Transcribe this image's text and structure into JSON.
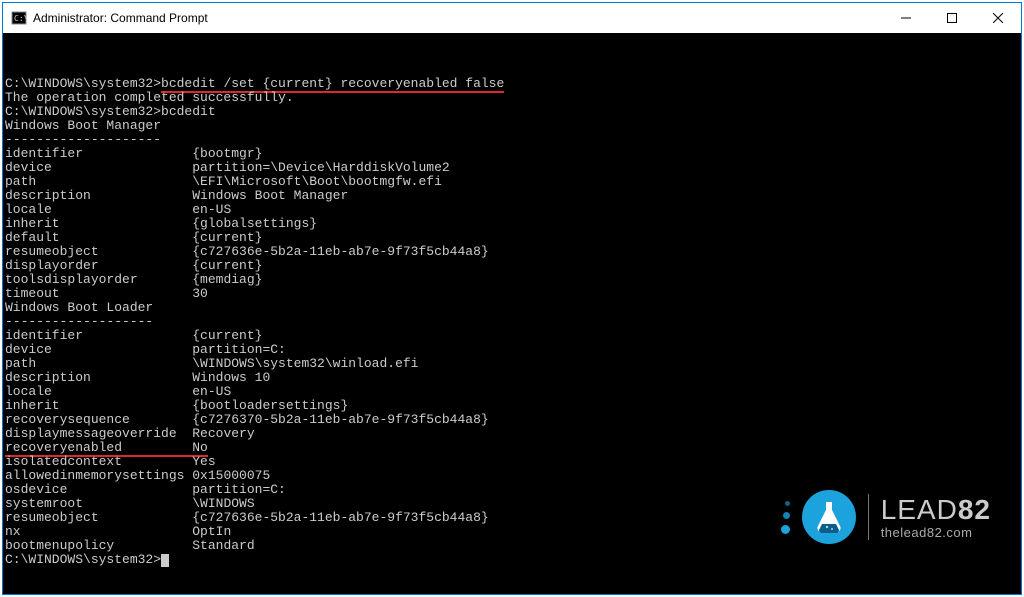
{
  "window": {
    "title": "Administrator: Command Prompt"
  },
  "terminal": {
    "prompt": "C:\\WINDOWS\\system32>",
    "cmd1": "bcdedit /set {current} recoveryenabled false",
    "cmd1_result": "The operation completed successfully.",
    "cmd2": "bcdedit",
    "section1_title": "Windows Boot Manager",
    "section1_divider": "--------------------",
    "section2_title": "Windows Boot Loader",
    "section2_divider": "-------------------",
    "bootmgr": [
      {
        "k": "identifier",
        "v": "{bootmgr}"
      },
      {
        "k": "device",
        "v": "partition=\\Device\\HarddiskVolume2"
      },
      {
        "k": "path",
        "v": "\\EFI\\Microsoft\\Boot\\bootmgfw.efi"
      },
      {
        "k": "description",
        "v": "Windows Boot Manager"
      },
      {
        "k": "locale",
        "v": "en-US"
      },
      {
        "k": "inherit",
        "v": "{globalsettings}"
      },
      {
        "k": "default",
        "v": "{current}"
      },
      {
        "k": "resumeobject",
        "v": "{c727636e-5b2a-11eb-ab7e-9f73f5cb44a8}"
      },
      {
        "k": "displayorder",
        "v": "{current}"
      },
      {
        "k": "toolsdisplayorder",
        "v": "{memdiag}"
      },
      {
        "k": "timeout",
        "v": "30"
      }
    ],
    "bootloader": [
      {
        "k": "identifier",
        "v": "{current}"
      },
      {
        "k": "device",
        "v": "partition=C:"
      },
      {
        "k": "path",
        "v": "\\WINDOWS\\system32\\winload.efi"
      },
      {
        "k": "description",
        "v": "Windows 10"
      },
      {
        "k": "locale",
        "v": "en-US"
      },
      {
        "k": "inherit",
        "v": "{bootloadersettings}"
      },
      {
        "k": "recoverysequence",
        "v": "{c7276370-5b2a-11eb-ab7e-9f73f5cb44a8}"
      },
      {
        "k": "displaymessageoverride",
        "v": "Recovery"
      },
      {
        "k": "recoveryenabled",
        "v": "No",
        "hl": true
      },
      {
        "k": "isolatedcontext",
        "v": "Yes"
      },
      {
        "k": "allowedinmemorysettings",
        "v": "0x15000075"
      },
      {
        "k": "osdevice",
        "v": "partition=C:"
      },
      {
        "k": "systemroot",
        "v": "\\WINDOWS"
      },
      {
        "k": "resumeobject",
        "v": "{c727636e-5b2a-11eb-ab7e-9f73f5cb44a8}"
      },
      {
        "k": "nx",
        "v": "OptIn"
      },
      {
        "k": "bootmenupolicy",
        "v": "Standard"
      }
    ]
  },
  "watermark": {
    "brand_left": "LEAD",
    "brand_right": "82",
    "url": "thelead82.com"
  }
}
